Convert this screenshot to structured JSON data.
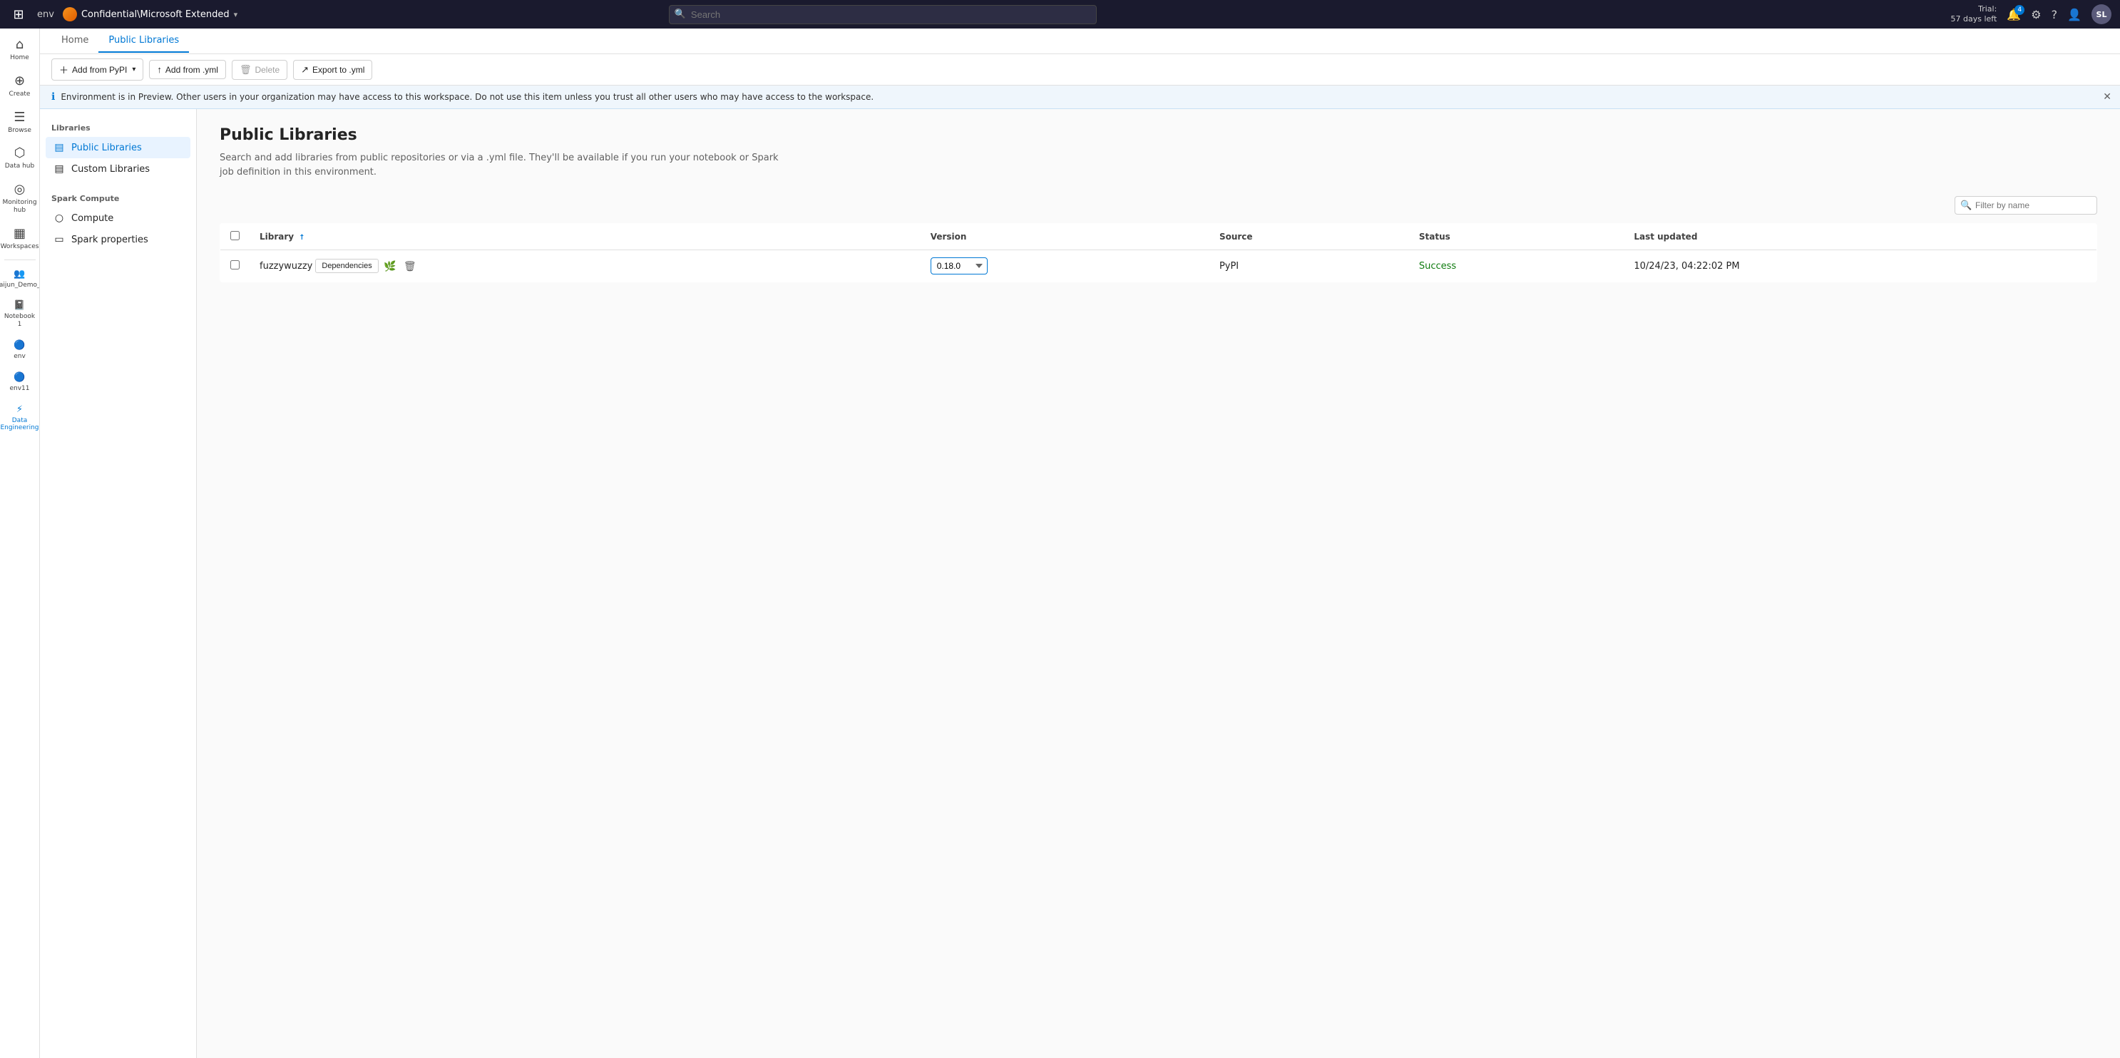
{
  "topbar": {
    "waffle_label": "⊞",
    "env_label": "env",
    "breadcrumb_text": "Confidential\\Microsoft Extended",
    "search_placeholder": "Search",
    "trial_line1": "Trial:",
    "trial_line2": "57 days left",
    "notification_count": "4",
    "avatar_initials": "SL"
  },
  "sidebar": {
    "items": [
      {
        "id": "home",
        "icon": "⌂",
        "label": "Home"
      },
      {
        "id": "create",
        "icon": "+",
        "label": "Create"
      },
      {
        "id": "browse",
        "icon": "☰",
        "label": "Browse"
      },
      {
        "id": "datahub",
        "icon": "⬡",
        "label": "Data hub"
      },
      {
        "id": "monitoring",
        "icon": "◎",
        "label": "Monitoring hub"
      },
      {
        "id": "workspaces",
        "icon": "▦",
        "label": "Workspaces"
      },
      {
        "id": "user1",
        "icon": "◌",
        "label": "Shuaijun_Demo_Env"
      },
      {
        "id": "notebook1",
        "icon": "◻",
        "label": "Notebook 1"
      },
      {
        "id": "env",
        "icon": "●",
        "label": "env"
      },
      {
        "id": "env11",
        "icon": "●",
        "label": "env11"
      },
      {
        "id": "dataeng",
        "icon": "⬡",
        "label": "Data Engineering",
        "active": true
      }
    ]
  },
  "tabs": [
    {
      "id": "home",
      "label": "Home",
      "active": false
    },
    {
      "id": "public-libraries",
      "label": "Public Libraries",
      "active": true
    }
  ],
  "toolbar": {
    "add_pypi_label": "Add from PyPI",
    "add_yml_label": "Add from .yml",
    "delete_label": "Delete",
    "export_label": "Export to .yml"
  },
  "banner": {
    "message": "Environment is in Preview. Other users in your organization may have access to this workspace. Do not use this item unless you trust all other users who may have access to the workspace."
  },
  "left_nav": {
    "section_label": "Libraries",
    "items": [
      {
        "id": "public-libraries",
        "icon": "▤",
        "label": "Public Libraries",
        "active": true
      },
      {
        "id": "custom-libraries",
        "icon": "▤",
        "label": "Custom Libraries",
        "active": false
      }
    ],
    "subsection_label": "Spark Compute",
    "sub_items": [
      {
        "id": "compute",
        "icon": "○",
        "label": "Compute"
      },
      {
        "id": "spark-properties",
        "icon": "▭",
        "label": "Spark properties"
      }
    ]
  },
  "main": {
    "title": "Public Libraries",
    "description": "Search and add libraries from public repositories or via a .yml file. They'll be available if you run your notebook or Spark job definition in this environment.",
    "filter_placeholder": "Filter by name",
    "table": {
      "columns": [
        {
          "id": "library",
          "label": "Library",
          "sortable": true
        },
        {
          "id": "version",
          "label": "Version"
        },
        {
          "id": "source",
          "label": "Source"
        },
        {
          "id": "status",
          "label": "Status"
        },
        {
          "id": "last_updated",
          "label": "Last updated"
        }
      ],
      "rows": [
        {
          "name": "fuzzywuzzy",
          "dependencies_label": "Dependencies",
          "version": "0.18.0",
          "source": "PyPI",
          "status": "Success",
          "last_updated": "10/24/23, 04:22:02 PM"
        }
      ]
    }
  }
}
